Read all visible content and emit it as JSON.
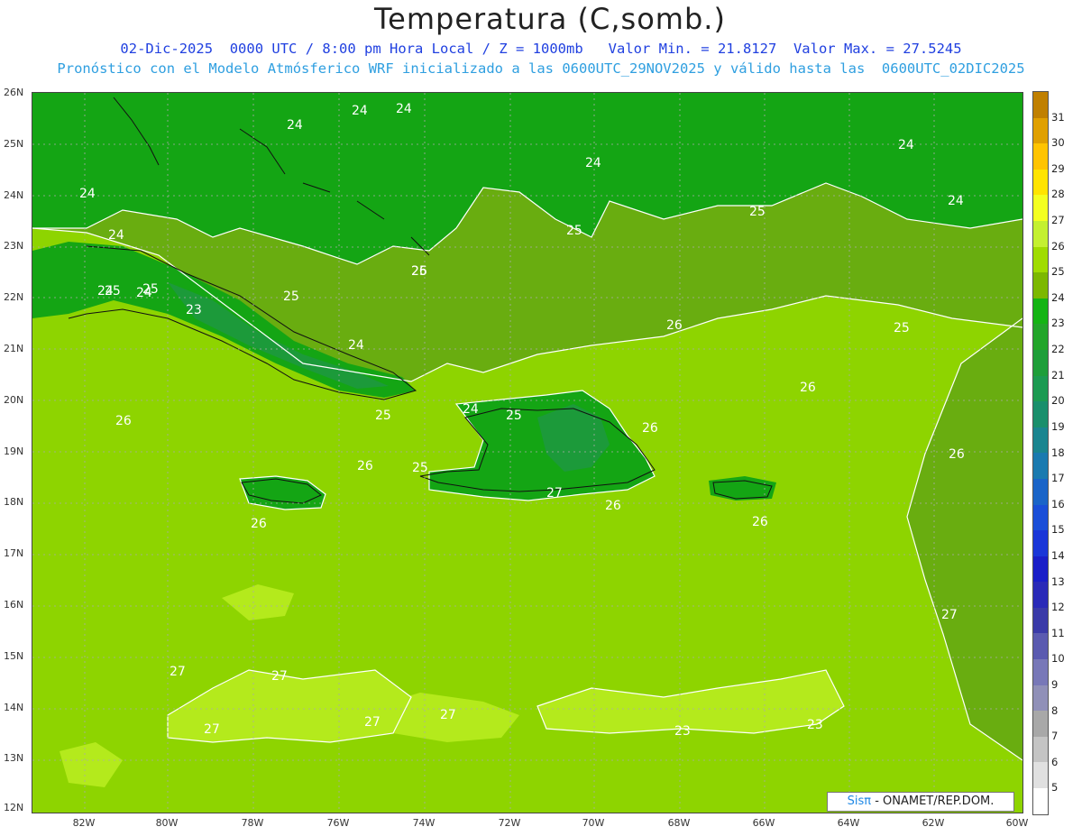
{
  "header": {
    "title": "Temperatura (C,somb.)",
    "subtitle_line1": "02-Dic-2025  0000 UTC / 8:00 pm Hora Local / Z = 1000mb   Valor Min. = 21.8127  Valor Max. = 27.5245",
    "subtitle_line2": "Pronóstico con el Modelo Atmósferico WRF inicializado a las 0600UTC_29NOV2025 y válido hasta las  0600UTC_02DIC2025"
  },
  "map": {
    "lat_labels": [
      "26N",
      "25N",
      "24N",
      "23N",
      "22N",
      "21N",
      "20N",
      "19N",
      "18N",
      "17N",
      "16N",
      "15N",
      "14N",
      "13N",
      "12N"
    ],
    "lon_labels": [
      "82W",
      "80W",
      "78W",
      "76W",
      "74W",
      "72W",
      "70W",
      "68W",
      "66W",
      "64W",
      "62W",
      "60W"
    ],
    "contour_labels": [
      "24",
      "24",
      "24",
      "24",
      "24",
      "24",
      "24",
      "24",
      "24",
      "24",
      "24",
      "24",
      "25",
      "25",
      "25",
      "25",
      "25",
      "25",
      "25",
      "25",
      "25",
      "25",
      "26",
      "26",
      "26",
      "26",
      "26",
      "26",
      "26",
      "26",
      "26",
      "26",
      "27",
      "27",
      "27",
      "27",
      "27",
      "27",
      "27",
      "23",
      "23",
      "23"
    ],
    "colors": {
      "t24": "#14a514",
      "t25": "#69ad10",
      "t26": "#8ed400",
      "t27": "#b4ea1c",
      "t23": "#1c9a3a",
      "coast": "#111111",
      "contour": "#ffffff",
      "grid": "#aaaaaa"
    }
  },
  "colorbar": {
    "labels": [
      "31",
      "30",
      "29",
      "28",
      "27",
      "26",
      "25",
      "24",
      "23",
      "22",
      "21",
      "20",
      "19",
      "18",
      "17",
      "16",
      "15",
      "14",
      "13",
      "12",
      "11",
      "10",
      "9",
      "8",
      "7",
      "6",
      "5"
    ],
    "colors": [
      "#c08000",
      "#e0a000",
      "#ffc400",
      "#ffe400",
      "#f4ff20",
      "#c4f030",
      "#a0dc00",
      "#7cb800",
      "#14b414",
      "#22a52a",
      "#1e9e3a",
      "#1c9a52",
      "#1a8f6c",
      "#1a8590",
      "#1a7ab0",
      "#1a64c8",
      "#1a4ed8",
      "#1a36d8",
      "#1a1ec8",
      "#2a2ab8",
      "#3a3aa8",
      "#5a5ab0",
      "#7878b8",
      "#9090b8",
      "#a8a8a8",
      "#c4c4c4",
      "#e0e0e0",
      "#ffffff"
    ]
  },
  "credit": {
    "brand": "Sisπ",
    "text": "- ONAMET/REP.DOM."
  }
}
